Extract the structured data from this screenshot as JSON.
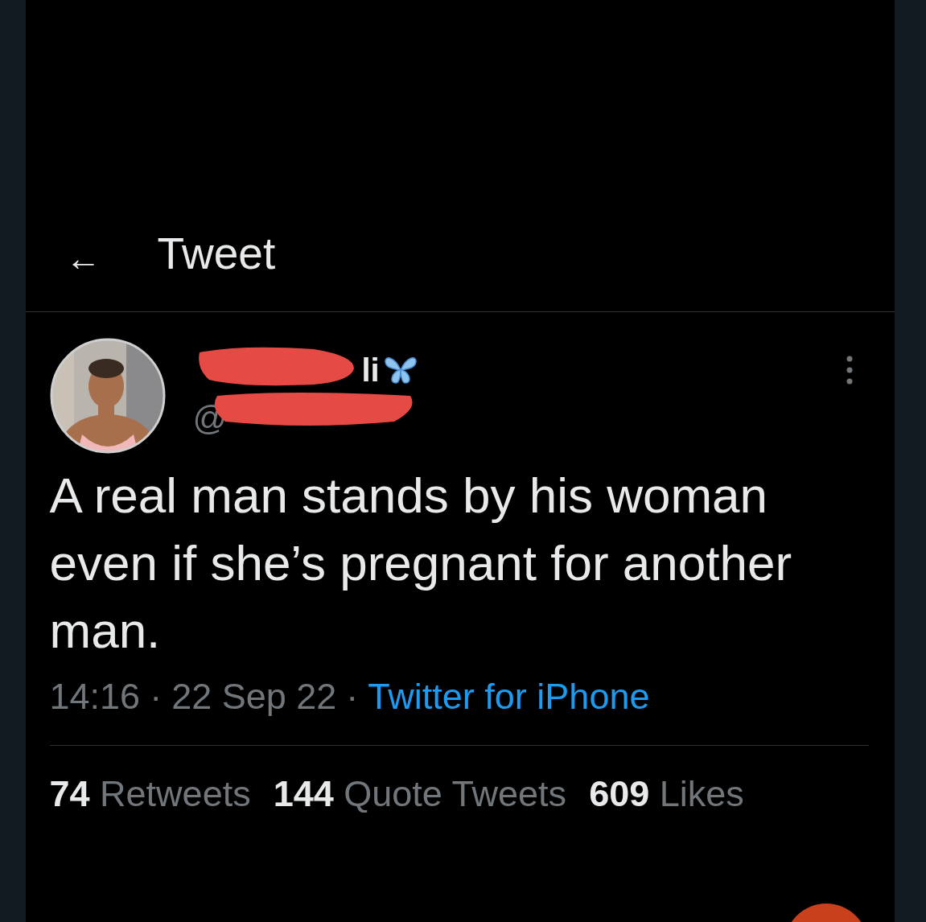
{
  "header": {
    "back_icon": "←",
    "title": "Tweet"
  },
  "author": {
    "name_visible": "li",
    "handle_visible": "@",
    "redacted": true
  },
  "tweet": {
    "text": "A real man stands by his woman even if she’s pregnant for another man.",
    "time": "14:16",
    "date": "22 Sep 22",
    "source": "Twitter for iPhone",
    "separator": "·"
  },
  "stats": [
    {
      "count": "74",
      "label": "Retweets"
    },
    {
      "count": "144",
      "label": "Quote Tweets"
    },
    {
      "count": "609",
      "label": "Likes"
    }
  ]
}
